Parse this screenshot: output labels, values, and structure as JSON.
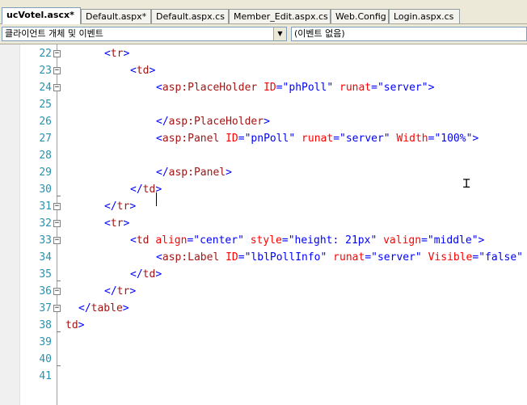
{
  "tabs": [
    {
      "label": "ucVotel.ascx*",
      "active": true
    },
    {
      "label": "Default.aspx*",
      "active": false
    },
    {
      "label": "Default.aspx.cs",
      "active": false
    },
    {
      "label": "Member_Edit.aspx.cs",
      "active": false
    },
    {
      "label": "Web.Config",
      "active": false
    },
    {
      "label": "Login.aspx.cs",
      "active": false
    }
  ],
  "dropdowns": {
    "client_objects": "클라이언트 개체 및 이벤트",
    "events": "(이벤트 없음)"
  },
  "editor": {
    "lines": [
      {
        "num": "22",
        "segs": [
          [
            "bl",
            "<"
          ],
          [
            "tg",
            "tr"
          ],
          [
            "bl",
            ">"
          ]
        ]
      },
      {
        "num": "23",
        "segs": [
          [
            "bl",
            "<"
          ],
          [
            "tg",
            "td"
          ],
          [
            "bl",
            ">"
          ]
        ]
      },
      {
        "num": "24",
        "segs": [
          [
            "bl",
            "<"
          ],
          [
            "tg",
            "asp:PlaceHolder"
          ],
          [
            "t",
            " "
          ],
          [
            "at",
            "ID"
          ],
          [
            "bl",
            "="
          ],
          [
            "vl",
            "\"phPoll\""
          ],
          [
            "t",
            " "
          ],
          [
            "at",
            "runat"
          ],
          [
            "bl",
            "="
          ],
          [
            "vl",
            "\"server\""
          ],
          [
            "bl",
            ">"
          ]
        ]
      },
      {
        "num": "25",
        "segs": []
      },
      {
        "num": "26",
        "segs": [
          [
            "bl",
            "</"
          ],
          [
            "tg",
            "asp:PlaceHolder"
          ],
          [
            "bl",
            ">"
          ]
        ]
      },
      {
        "num": "27",
        "segs": [
          [
            "bl",
            "<"
          ],
          [
            "tg",
            "asp:Panel"
          ],
          [
            "t",
            " "
          ],
          [
            "at",
            "ID"
          ],
          [
            "bl",
            "="
          ],
          [
            "vl",
            "\"pnPoll\""
          ],
          [
            "t",
            " "
          ],
          [
            "at",
            "runat"
          ],
          [
            "bl",
            "="
          ],
          [
            "vl",
            "\"server\""
          ],
          [
            "t",
            " "
          ],
          [
            "at",
            "Width"
          ],
          [
            "bl",
            "="
          ],
          [
            "vl",
            "\"100%\""
          ],
          [
            "bl",
            ">"
          ]
        ]
      },
      {
        "num": "28",
        "segs": []
      },
      {
        "num": "29",
        "segs": [
          [
            "bl",
            "</"
          ],
          [
            "tg",
            "asp:Panel"
          ],
          [
            "bl",
            ">"
          ]
        ]
      },
      {
        "num": "30",
        "segs": [
          [
            "bl",
            "</"
          ],
          [
            "tg",
            "td"
          ],
          [
            "bl",
            ">"
          ]
        ]
      },
      {
        "num": "31",
        "segs": [
          [
            "bl",
            "</"
          ],
          [
            "tg",
            "tr"
          ],
          [
            "bl",
            ">"
          ]
        ]
      },
      {
        "num": "32",
        "segs": [
          [
            "bl",
            "<"
          ],
          [
            "tg",
            "tr"
          ],
          [
            "bl",
            ">"
          ]
        ]
      },
      {
        "num": "33",
        "segs": [
          [
            "bl",
            "<"
          ],
          [
            "tg",
            "td"
          ],
          [
            "t",
            " "
          ],
          [
            "at",
            "align"
          ],
          [
            "bl",
            "="
          ],
          [
            "vl",
            "\"center\""
          ],
          [
            "t",
            " "
          ],
          [
            "at",
            "style"
          ],
          [
            "bl",
            "="
          ],
          [
            "vl",
            "\"height: 21px\""
          ],
          [
            "t",
            " "
          ],
          [
            "at",
            "valign"
          ],
          [
            "bl",
            "="
          ],
          [
            "vl",
            "\"middle\""
          ],
          [
            "bl",
            ">"
          ]
        ]
      },
      {
        "num": "34",
        "segs": [
          [
            "bl",
            "<"
          ],
          [
            "tg",
            "asp:Label"
          ],
          [
            "t",
            " "
          ],
          [
            "at",
            "ID"
          ],
          [
            "bl",
            "="
          ],
          [
            "vl",
            "\"lblPollInfo\""
          ],
          [
            "t",
            " "
          ],
          [
            "at",
            "runat"
          ],
          [
            "bl",
            "="
          ],
          [
            "vl",
            "\"server\""
          ],
          [
            "t",
            " "
          ],
          [
            "at",
            "Visible"
          ],
          [
            "bl",
            "="
          ],
          [
            "vl",
            "\"false\""
          ]
        ]
      },
      {
        "num": "35",
        "segs": [
          [
            "bl",
            "</"
          ],
          [
            "tg",
            "td"
          ],
          [
            "bl",
            ">"
          ]
        ]
      },
      {
        "num": "36",
        "segs": [
          [
            "bl",
            "</"
          ],
          [
            "tg",
            "tr"
          ],
          [
            "bl",
            ">"
          ]
        ]
      },
      {
        "num": "37",
        "segs": [
          [
            "bl",
            "</"
          ],
          [
            "tg",
            "table"
          ],
          [
            "bl",
            ">"
          ]
        ]
      },
      {
        "num": "38",
        "segs": [
          [
            "tg",
            "td"
          ],
          [
            "bl",
            ">"
          ]
        ]
      },
      {
        "num": "39",
        "segs": []
      },
      {
        "num": "40",
        "segs": []
      },
      {
        "num": "41",
        "segs": []
      }
    ]
  },
  "colors": {
    "line_number": "#2b91af",
    "tag": "#a31515",
    "bracket": "#0000ff",
    "attribute": "#ff0000",
    "value": "#0000ff"
  }
}
